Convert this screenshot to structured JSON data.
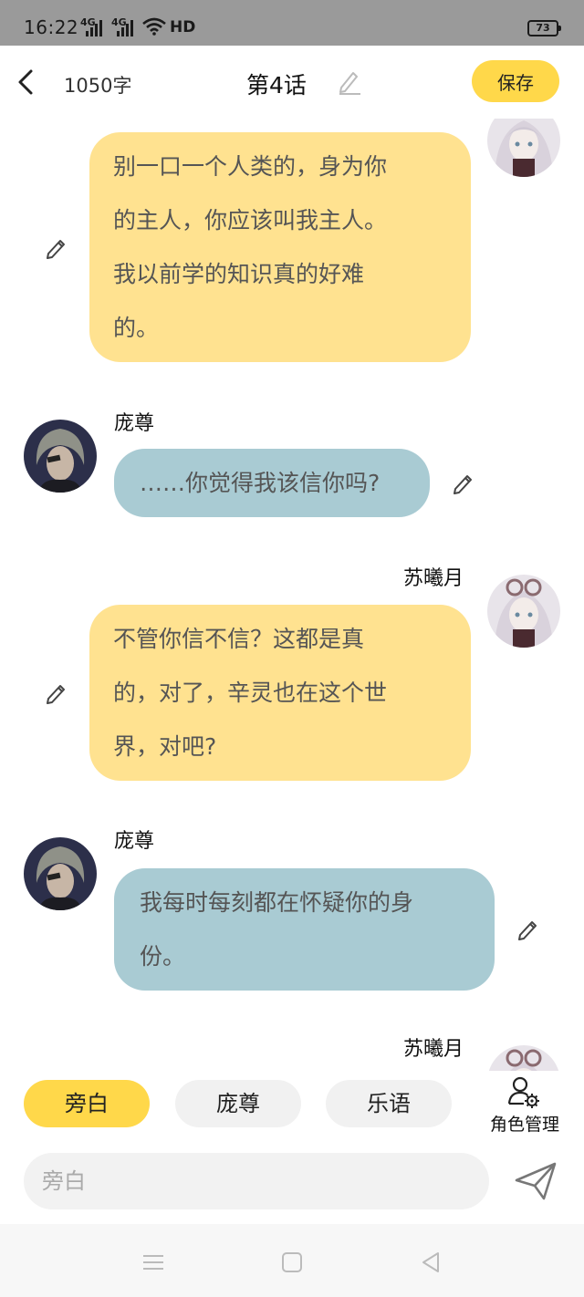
{
  "status_bar": {
    "time": "16:22",
    "network_1": "4G",
    "network_2": "4G",
    "hd": "HD",
    "battery": "73"
  },
  "header": {
    "word_count": "1050字",
    "title": "第4话",
    "save_label": "保存"
  },
  "messages": [
    {
      "speaker": "",
      "side": "right",
      "style": "yellow",
      "lines": [
        "别一口一个人类的，身为你",
        "的主人，你应该叫我主人。",
        "我以前学的知识真的好难",
        "的。"
      ]
    },
    {
      "speaker": "庞尊",
      "side": "left",
      "style": "blue",
      "lines": [
        "……你觉得我该信你吗?"
      ]
    },
    {
      "speaker": "苏曦月",
      "side": "right",
      "style": "yellow",
      "lines": [
        "不管你信不信？这都是真",
        "的，对了，辛灵也在这个世",
        "界，对吧?"
      ]
    },
    {
      "speaker": "庞尊",
      "side": "left",
      "style": "blue",
      "lines": [
        "我每时每刻都在怀疑你的身",
        "份。"
      ]
    },
    {
      "speaker": "苏曦月",
      "side": "right",
      "style": "yellow",
      "lines": []
    }
  ],
  "roles": {
    "chips": [
      "旁白",
      "庞尊",
      "乐语"
    ],
    "active": "旁白",
    "manage_label": "角色管理"
  },
  "input": {
    "placeholder": "旁白"
  },
  "colors": {
    "accent": "#ffd84a",
    "bubble_yellow": "#ffe290",
    "bubble_blue": "#a9cbd3"
  }
}
